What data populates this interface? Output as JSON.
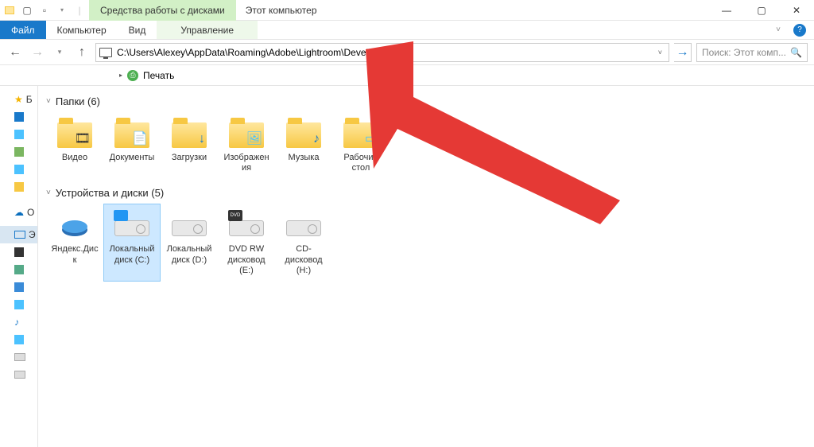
{
  "titlebar": {
    "context_tab": "Средства работы с дисками",
    "window_title": "Этот компьютер"
  },
  "ribbon": {
    "file": "Файл",
    "tabs": [
      "Компьютер",
      "Вид"
    ],
    "context_lower": "Управление"
  },
  "nav": {
    "address": "C:\\Users\\Alexey\\AppData\\Roaming\\Adobe\\Lightroom\\Develop Prese",
    "search_placeholder": "Поиск: Этот комп..."
  },
  "printbar": {
    "label": "Печать"
  },
  "sidebar": {
    "items": [
      {
        "label": "Б"
      },
      {
        "label": ""
      },
      {
        "label": ""
      },
      {
        "label": ""
      },
      {
        "label": ""
      },
      {
        "label": ""
      },
      {
        "label": ""
      },
      {
        "label": "O"
      },
      {
        "label": "Э"
      },
      {
        "label": ""
      },
      {
        "label": ""
      },
      {
        "label": ""
      },
      {
        "label": ""
      },
      {
        "label": ""
      },
      {
        "label": ""
      },
      {
        "label": ""
      },
      {
        "label": ""
      }
    ]
  },
  "content": {
    "group_folders": {
      "title": "Папки",
      "count": 6
    },
    "folders": [
      {
        "name": "Видео"
      },
      {
        "name": "Документы"
      },
      {
        "name": "Загрузки"
      },
      {
        "name": "Изображения"
      },
      {
        "name": "Музыка"
      },
      {
        "name": "Рабочий стол"
      }
    ],
    "group_devices": {
      "title": "Устройства и диски",
      "count": 5
    },
    "devices": [
      {
        "name": "Яндекс.Диск"
      },
      {
        "name": "Локальный диск (C:)"
      },
      {
        "name": "Локальный диск (D:)"
      },
      {
        "name": "DVD RW дисковод (E:)"
      },
      {
        "name": "CD-дисковод (H:)"
      }
    ]
  }
}
